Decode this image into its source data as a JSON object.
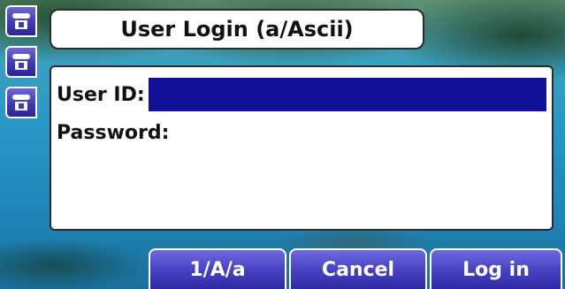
{
  "header": {
    "title": "User Login (a/Ascii)"
  },
  "line_keys": [
    {
      "icon": "phone-handset-icon"
    },
    {
      "icon": "phone-handset-icon"
    },
    {
      "icon": "phone-handset-icon"
    }
  ],
  "login_form": {
    "user_id_label": "User ID:",
    "user_id_value": "",
    "password_label": "Password:",
    "password_value": ""
  },
  "softkeys": {
    "mode_label": "1/A/a",
    "cancel_label": "Cancel",
    "login_label": "Log in"
  },
  "colors": {
    "softkey": "#4842c4",
    "input_highlight": "#11119a",
    "panel": "#ffffff"
  }
}
